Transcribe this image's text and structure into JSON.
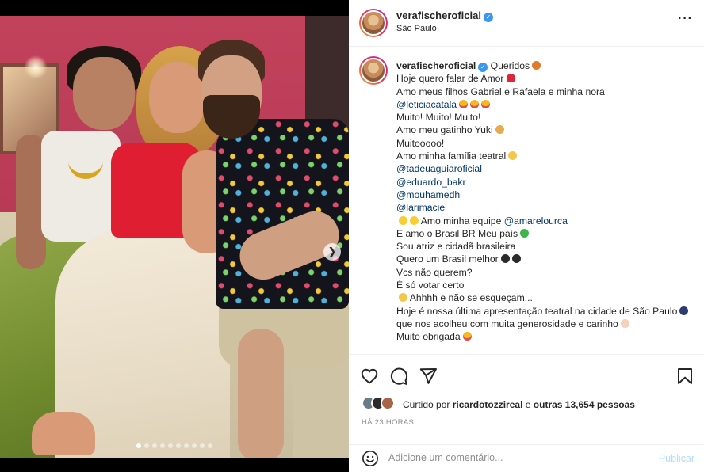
{
  "post": {
    "username": "verafischeroficial",
    "location": "São Paulo",
    "photo_alt": "Foto de Vera Fischer com a família no sofá",
    "carousel": {
      "total": 10,
      "active": 0
    }
  },
  "caption": {
    "username": "verafischeroficial",
    "lines": [
      {
        "text": "Queridos",
        "emoji": "butterfly"
      },
      {
        "text": "Hoje quero falar de Amor",
        "emoji": "red-heart"
      },
      {
        "text": "Amo meus filhos Gabriel e Rafaela e minha nora"
      },
      {
        "mention": "@leticiacatala",
        "emojis": [
          "smiling-face-with-hearts",
          "smiling-face-with-hearts",
          "smiling-face-with-hearts"
        ]
      },
      {
        "text": "Muito! Muito! Muito!"
      },
      {
        "text_before": "Amo meu gatinho",
        "emoji": "cat",
        "text_after": "Yuki"
      },
      {
        "text": "Muitooooo!"
      },
      {
        "text": "Amo minha família teatral",
        "emoji": "performing-arts"
      },
      {
        "mention": "@tadeuaguiaroficial"
      },
      {
        "mention": "@eduardo_bakr"
      },
      {
        "mention": "@mouhamedh"
      },
      {
        "mention": "@larimaciel"
      },
      {
        "prefix_emojis": [
          "yellow-heart",
          "yellow-heart"
        ],
        "text": "Amo minha equipe",
        "mention": "@amarelourca"
      },
      {
        "text_before": "E amo o Brasil",
        "flag": "BR",
        "text_after": "Meu país",
        "emoji": "green-heart"
      },
      {
        "text": "Sou atriz e cidadã brasileira"
      },
      {
        "text": "Quero um Brasil melhor",
        "emojis": [
          "black-heart",
          "paw-prints"
        ]
      },
      {
        "text": "Vcs não querem?"
      },
      {
        "text": "É só votar certo"
      },
      {
        "prefix_emoji": "performing-arts",
        "text": "Ahhhh e não se esqueçam..."
      },
      {
        "text": "Hoje é nossa última apresentação teatral na cidade de São Paulo",
        "emoji": "night-with-stars",
        "wrap": true
      },
      {
        "text": "que nos acolheu com muita generosidade e carinho",
        "emoji": "folded-hands"
      },
      {
        "text": "Muito obrigada",
        "emoji": "heart-eyes"
      }
    ]
  },
  "actions": {
    "like_icon": "heart-icon",
    "comment_icon": "comment-icon",
    "share_icon": "send-icon",
    "save_icon": "bookmark-icon"
  },
  "likes": {
    "prefix": "Curtido por",
    "user": "ricardotozzireal",
    "middle": "e",
    "others": "outras 13,654 pessoas"
  },
  "timestamp": "HÁ 23 HORAS",
  "comment": {
    "placeholder": "Adicione um comentário...",
    "publish_label": "Publicar"
  },
  "colors": {
    "verified": "#3897f0",
    "mention": "#00376b",
    "publish_disabled": "#b3dbff",
    "story_ring_start": "#f9a72b",
    "story_ring_end": "#b72fa7"
  }
}
